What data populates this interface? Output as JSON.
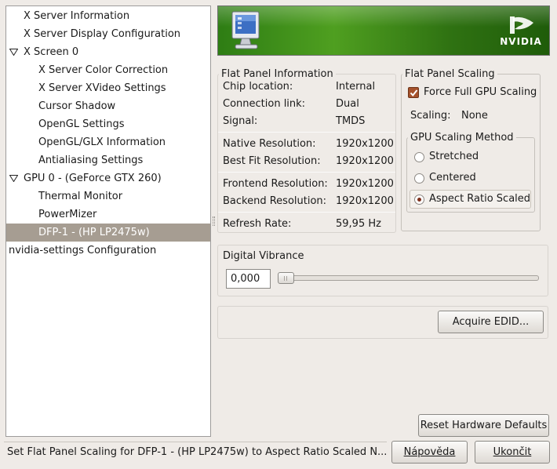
{
  "tree": {
    "items": [
      {
        "label": "X Server Information",
        "level": 1,
        "expander": false,
        "selected": false
      },
      {
        "label": "X Server Display Configuration",
        "level": 1,
        "expander": false,
        "selected": false
      },
      {
        "label": "X Screen 0",
        "level": 1,
        "expander": true,
        "selected": false
      },
      {
        "label": "X Server Color Correction",
        "level": 2,
        "expander": false,
        "selected": false
      },
      {
        "label": "X Server XVideo Settings",
        "level": 2,
        "expander": false,
        "selected": false
      },
      {
        "label": "Cursor Shadow",
        "level": 2,
        "expander": false,
        "selected": false
      },
      {
        "label": "OpenGL Settings",
        "level": 2,
        "expander": false,
        "selected": false
      },
      {
        "label": "OpenGL/GLX Information",
        "level": 2,
        "expander": false,
        "selected": false
      },
      {
        "label": "Antialiasing Settings",
        "level": 2,
        "expander": false,
        "selected": false
      },
      {
        "label": "GPU 0 - (GeForce GTX 260)",
        "level": 1,
        "expander": true,
        "selected": false
      },
      {
        "label": "Thermal Monitor",
        "level": 2,
        "expander": false,
        "selected": false
      },
      {
        "label": "PowerMizer",
        "level": 2,
        "expander": false,
        "selected": false
      },
      {
        "label": "DFP-1 - (HP LP2475w)",
        "level": 2,
        "expander": false,
        "selected": true
      },
      {
        "label": "nvidia-settings Configuration",
        "level": 0,
        "expander": false,
        "selected": false
      }
    ]
  },
  "banner": {
    "brand": "NVIDIA"
  },
  "flat_panel_info": {
    "title": "Flat Panel Information",
    "chip_location_label": "Chip location:",
    "chip_location_value": "Internal",
    "connection_link_label": "Connection link:",
    "connection_link_value": "Dual",
    "signal_label": "Signal:",
    "signal_value": "TMDS",
    "native_res_label": "Native Resolution:",
    "native_res_value": "1920x1200",
    "best_fit_label": "Best Fit Resolution:",
    "best_fit_value": "1920x1200",
    "frontend_label": "Frontend Resolution:",
    "frontend_value": "1920x1200",
    "backend_label": "Backend Resolution:",
    "backend_value": "1920x1200",
    "refresh_label": "Refresh Rate:",
    "refresh_value": "59,95 Hz"
  },
  "flat_panel_scaling": {
    "title": "Flat Panel Scaling",
    "force_full_label": "Force Full GPU Scaling",
    "force_full_checked": true,
    "scaling_label": "Scaling:",
    "scaling_value": "None",
    "method_title": "GPU Scaling Method",
    "options": [
      "Stretched",
      "Centered",
      "Aspect Ratio Scaled"
    ],
    "selected_option": "Aspect Ratio Scaled"
  },
  "digital_vibrance": {
    "title": "Digital Vibrance",
    "value": "0,000",
    "level": 0.0
  },
  "buttons": {
    "acquire_edid": "Acquire EDID...",
    "reset_defaults": "Reset Hardware Defaults",
    "help": "Nápověda",
    "quit": "Ukončit"
  },
  "status": {
    "text": "Set Flat Panel Scaling for DFP-1 - (HP LP2475w) to Aspect Ratio Scaled N..."
  },
  "colors": {
    "window_bg": "#efebe7",
    "selection": "#a69d92",
    "nvidia_green": "#76b900"
  },
  "icons": {
    "banner_left": "monitor-icon",
    "banner_right": "nvidia-logo-icon",
    "expander": "triangle-down-icon",
    "checkbox": "checkmark-icon"
  }
}
